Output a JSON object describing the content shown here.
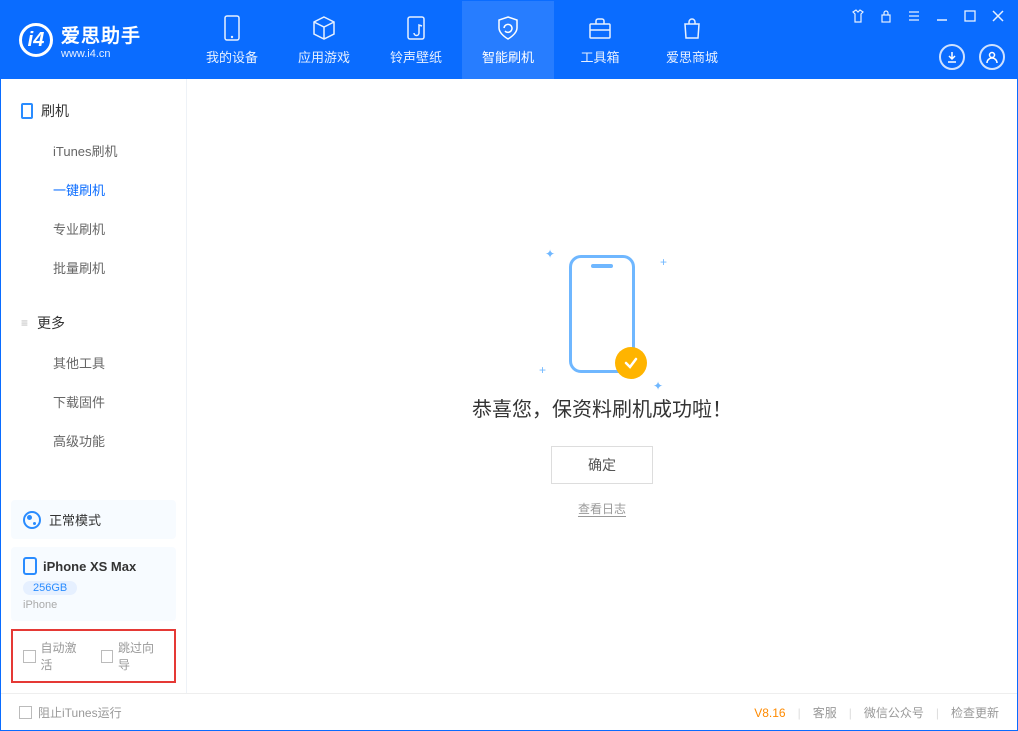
{
  "app": {
    "name_cn": "爱思助手",
    "name_en": "www.i4.cn"
  },
  "nav": {
    "my_device": "我的设备",
    "apps_games": "应用游戏",
    "ringtones": "铃声壁纸",
    "smart_flash": "智能刷机",
    "toolbox": "工具箱",
    "store": "爱思商城"
  },
  "sidebar": {
    "flash": {
      "title": "刷机",
      "items": [
        "iTunes刷机",
        "一键刷机",
        "专业刷机",
        "批量刷机"
      ]
    },
    "more": {
      "title": "更多",
      "items": [
        "其他工具",
        "下载固件",
        "高级功能"
      ]
    },
    "mode": "正常模式",
    "device": {
      "name": "iPhone XS Max",
      "storage": "256GB",
      "type": "iPhone"
    },
    "opt_auto_activate": "自动激活",
    "opt_skip_guide": "跳过向导"
  },
  "main": {
    "success_text": "恭喜您，保资料刷机成功啦！",
    "ok_button": "确定",
    "view_log": "查看日志"
  },
  "footer": {
    "stop_itunes": "阻止iTunes运行",
    "version": "V8.16",
    "support": "客服",
    "wechat": "微信公众号",
    "check_update": "检查更新"
  }
}
